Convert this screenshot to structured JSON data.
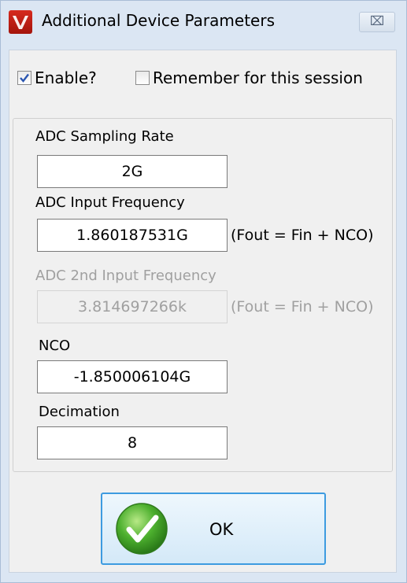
{
  "window": {
    "title": "Additional Device Parameters",
    "close_symbol": "⌧"
  },
  "options": {
    "enable_label": "Enable?",
    "enable_checked": true,
    "remember_label": "Remember for this session",
    "remember_checked": false
  },
  "fields": {
    "sampling_rate": {
      "label": "ADC Sampling Rate",
      "value": "2G"
    },
    "input_frequency": {
      "label": "ADC Input  Frequency",
      "value": "1.860187531G",
      "note": "(Fout = Fin + NCO)"
    },
    "second_input_frequency": {
      "label": "ADC 2nd Input  Frequency",
      "value": "3.814697266k",
      "note": "(Fout = Fin + NCO)",
      "enabled": false
    },
    "nco": {
      "label": "NCO",
      "value": "-1.850006104G"
    },
    "decimation": {
      "label": "Decimation",
      "value": "8"
    }
  },
  "ok_button": {
    "label": "OK",
    "icon": "green-checkmark-icon"
  },
  "colors": {
    "title_bar": "#dbe6f3",
    "app_icon": "#c8281b",
    "ok_border": "#3d9be0",
    "check_green": "#3fa42c",
    "disabled_text": "#a0a0a0"
  }
}
